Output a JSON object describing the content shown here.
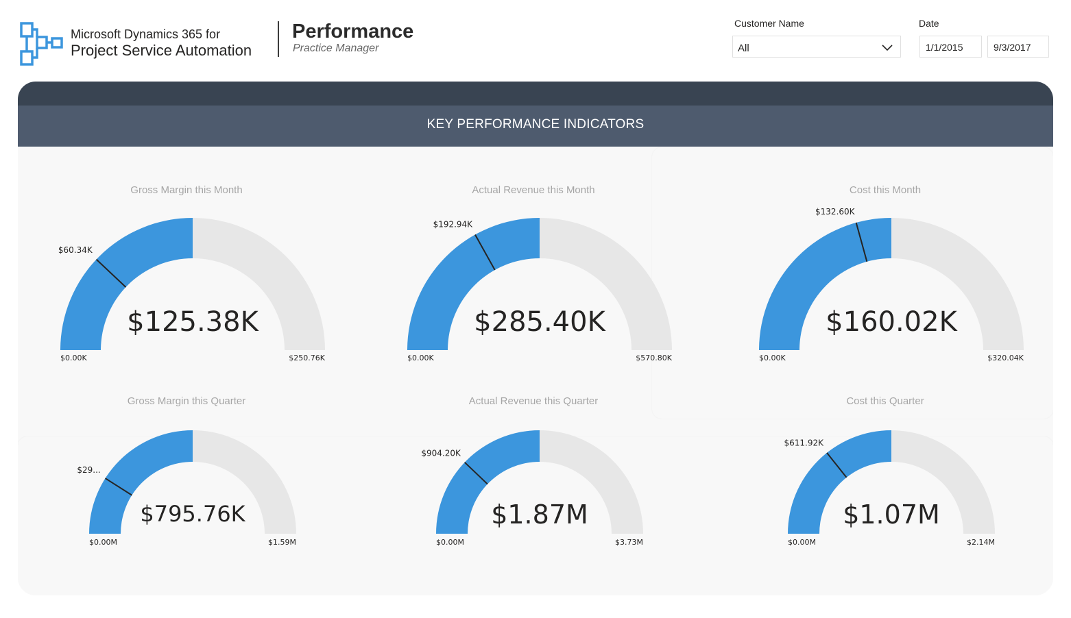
{
  "header": {
    "brand_line1": "Microsoft Dynamics 365 for",
    "brand_line2": "Project Service Automation",
    "title": "Performance",
    "subtitle": "Practice Manager"
  },
  "filters": {
    "customer_label": "Customer Name",
    "customer_value": "All",
    "date_label": "Date",
    "date_start": "1/1/2015",
    "date_end": "9/3/2017"
  },
  "panel": {
    "title": "KEY PERFORMANCE INDICATORS"
  },
  "colors": {
    "fill": "#3c96dd",
    "track": "#e7e7e7",
    "needle": "#252423",
    "header": "#4e5b6e",
    "header_top": "#394452"
  },
  "gauges": [
    {
      "title": "Gross Margin this Month",
      "value": "$125.38K",
      "min": "$0.00K",
      "max": "$250.76K",
      "target": "$60.34K",
      "fill_fraction": 0.5,
      "target_fraction": 0.2406
    },
    {
      "title": "Actual Revenue this Month",
      "value": "$285.40K",
      "min": "$0.00K",
      "max": "$570.80K",
      "target": "$192.94K",
      "fill_fraction": 0.5,
      "target_fraction": 0.338
    },
    {
      "title": "Cost this Month",
      "value": "$160.02K",
      "min": "$0.00K",
      "max": "$320.04K",
      "target": "$132.60K",
      "fill_fraction": 0.5,
      "target_fraction": 0.4143
    },
    {
      "title": "Gross Margin this Quarter",
      "value": "$795.76K",
      "min": "$0.00M",
      "max": "$1.59M",
      "target": "$29...",
      "fill_fraction": 0.5,
      "target_fraction": 0.18
    },
    {
      "title": "Actual Revenue this Quarter",
      "value": "$1.87M",
      "min": "$0.00M",
      "max": "$3.73M",
      "target": "$904.20K",
      "fill_fraction": 0.5,
      "target_fraction": 0.2424
    },
    {
      "title": "Cost this Quarter",
      "value": "$1.07M",
      "min": "$0.00M",
      "max": "$2.14M",
      "target": "$611.92K",
      "fill_fraction": 0.5,
      "target_fraction": 0.286
    }
  ]
}
